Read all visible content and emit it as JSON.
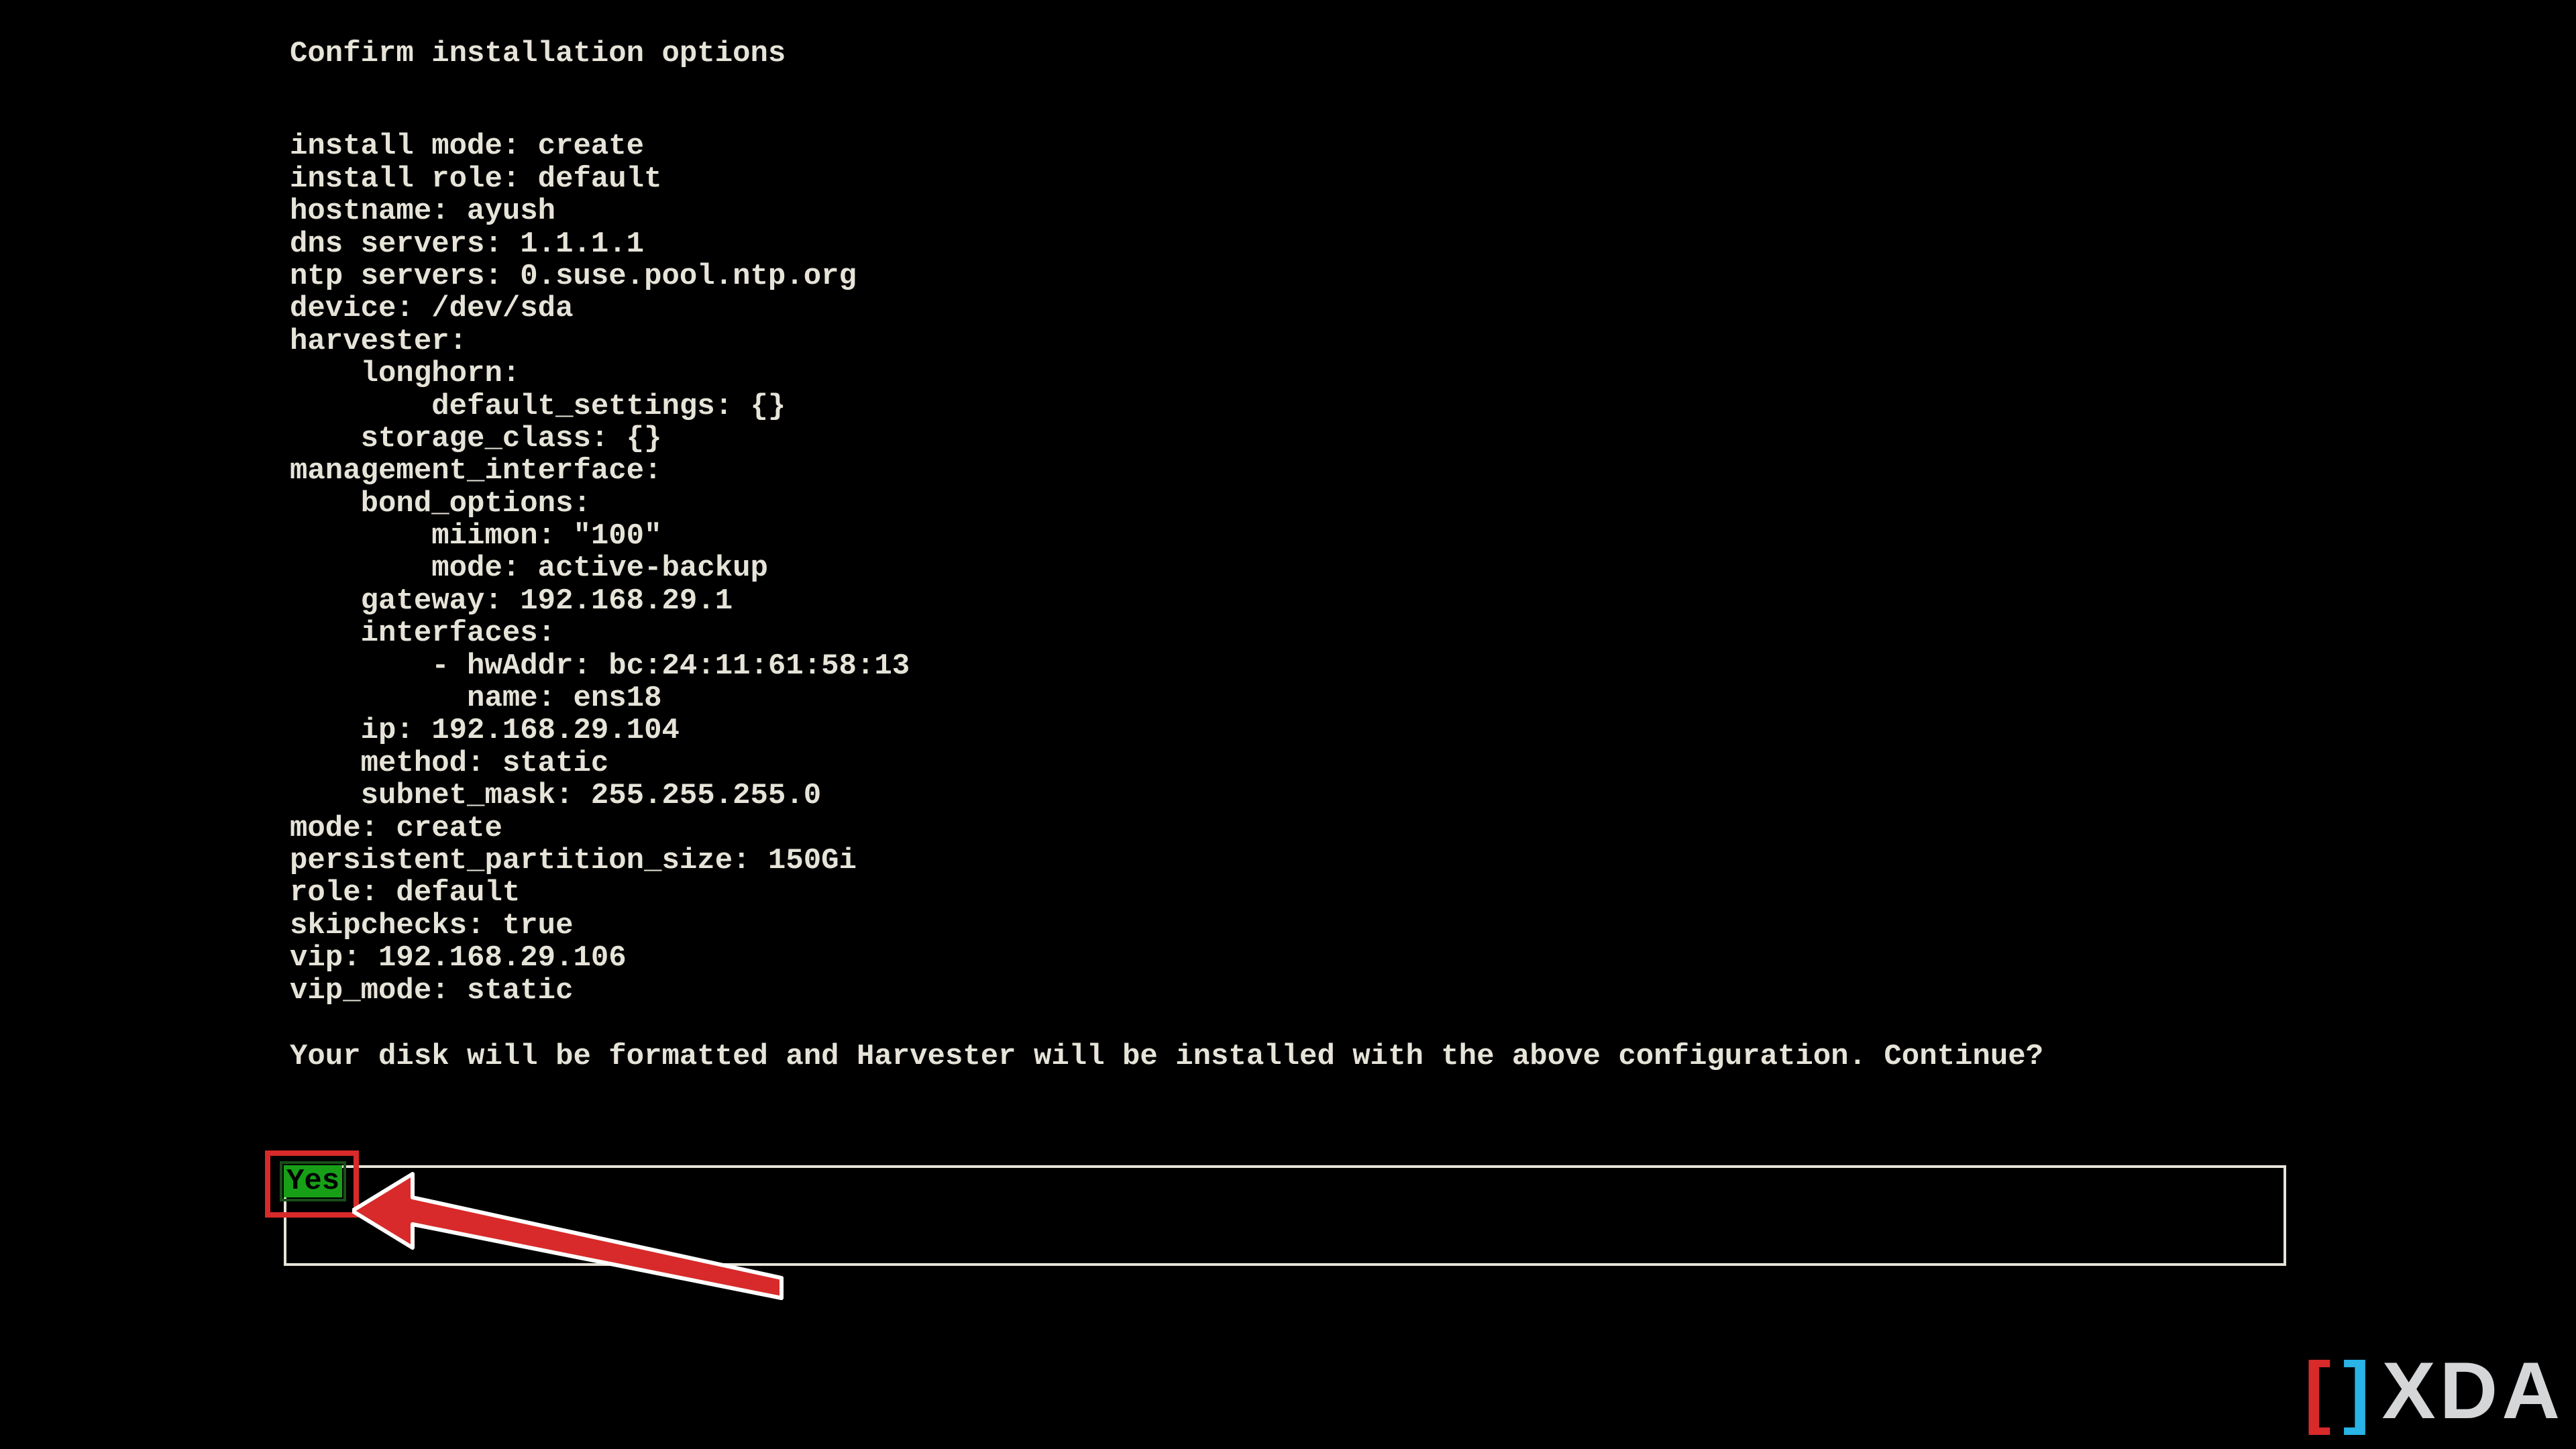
{
  "header": {
    "title": "Confirm installation options"
  },
  "config": {
    "lines": "install mode: create\ninstall role: default\nhostname: ayush\ndns servers: 1.1.1.1\nntp servers: 0.suse.pool.ntp.org\ndevice: /dev/sda\nharvester:\n    longhorn:\n        default_settings: {}\n    storage_class: {}\nmanagement_interface:\n    bond_options:\n        miimon: \"100\"\n        mode: active-backup\n    gateway: 192.168.29.1\n    interfaces:\n        - hwAddr: bc:24:11:61:58:13\n          name: ens18\n    ip: 192.168.29.104\n    method: static\n    subnet_mask: 255.255.255.0\nmode: create\npersistent_partition_size: 150Gi\nrole: default\nskipchecks: true\nvip: 192.168.29.106\nvip_mode: static"
  },
  "prompt": {
    "text": "Your disk will be formatted and Harvester will be installed with the above configuration. Continue?"
  },
  "options": {
    "selected": "Yes"
  },
  "watermark": {
    "open": "[",
    "close": "]",
    "text": "XDA"
  }
}
